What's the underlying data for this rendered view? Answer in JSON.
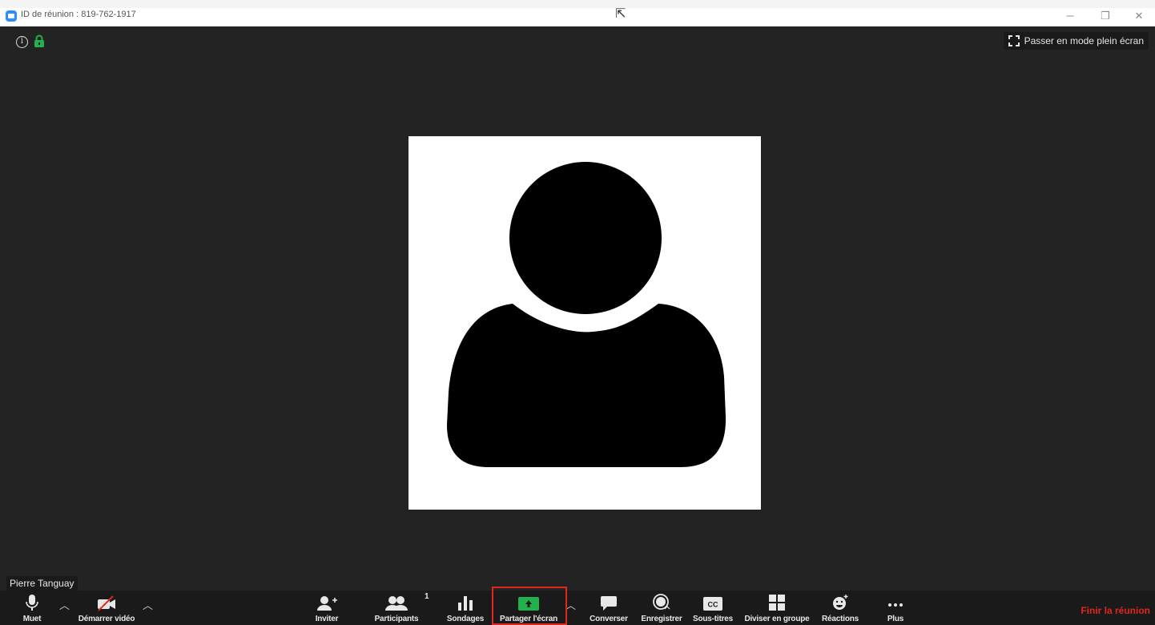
{
  "window": {
    "title": "ID de réunion : 819-762-1917",
    "controls": {
      "minimize": "─",
      "restore": "❐",
      "close": "✕"
    }
  },
  "top": {
    "fullscreen_label": "Passer en mode plein écran"
  },
  "participant": {
    "name": "Pierre Tanguay"
  },
  "toolbar": {
    "mute": "Muet",
    "start_video": "Démarrer vidéo",
    "invite": "Inviter",
    "participants": "Participants",
    "participants_count": "1",
    "polls": "Sondages",
    "share_screen": "Partager l'écran",
    "chat": "Converser",
    "record": "Enregistrer",
    "captions": "Sous-titres",
    "breakout": "Diviser en groupe",
    "reactions": "Réactions",
    "more": "Plus",
    "end_meeting": "Finir la réunion"
  },
  "colors": {
    "accent_green": "#22b14c",
    "end_red": "#e1261c",
    "app_blue": "#2d8cff"
  }
}
